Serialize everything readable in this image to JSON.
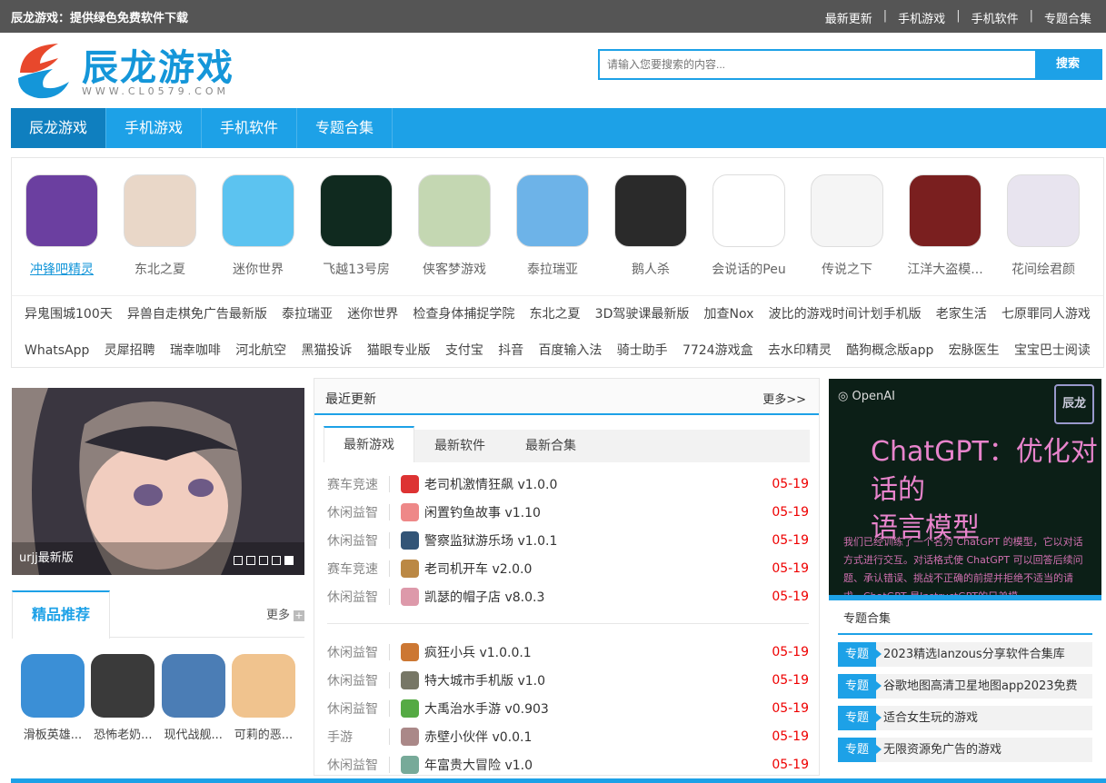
{
  "topbar": {
    "title": "辰龙游戏：提供绿色免费软件下载",
    "links": [
      "最新更新",
      "手机游戏",
      "手机软件",
      "专题合集"
    ],
    "separator": "|"
  },
  "logo": {
    "brand": "辰龙游戏",
    "url": "WWW.CL0579.COM"
  },
  "search": {
    "placeholder": "请输入您要搜索的内容...",
    "button": "搜索"
  },
  "nav": [
    "辰龙游戏",
    "手机游戏",
    "手机软件",
    "专题合集"
  ],
  "apps": [
    {
      "name": "冲锋吧精灵",
      "color": "#6b3fa0",
      "icon": "pokemon-icon"
    },
    {
      "name": "东北之夏",
      "color": "#e9d7c8",
      "icon": "anime-girls-icon"
    },
    {
      "name": "迷你世界",
      "color": "#5cc3f0",
      "icon": "mini-world-icon"
    },
    {
      "name": "飞越13号房",
      "color": "#102a1f",
      "icon": "room13-icon"
    },
    {
      "name": "侠客梦游戏",
      "color": "#c4d7b2",
      "icon": "swordsman-icon"
    },
    {
      "name": "泰拉瑞亚",
      "color": "#6db3e8",
      "icon": "terraria-tree-icon"
    },
    {
      "name": "鹅人杀",
      "color": "#2a2a2a",
      "icon": "goose-icon"
    },
    {
      "name": "会说话的Peu",
      "color": "#ffffff",
      "icon": "peu-icon"
    },
    {
      "name": "传说之下",
      "color": "#f5f5f5",
      "icon": "heart-icon"
    },
    {
      "name": "江洋大盗模...",
      "color": "#7a1f1f",
      "icon": "thief-icon"
    },
    {
      "name": "花间绘君颜",
      "color": "#e8e4ef",
      "icon": "anime-man-icon"
    }
  ],
  "tags": [
    [
      "异鬼围城100天",
      "异兽自走棋免广告最新版",
      "泰拉瑞亚",
      "迷你世界",
      "检查身体捕捉学院",
      "东北之夏",
      "3D驾驶课最新版",
      "加查Nox",
      "波比的游戏时间计划手机版",
      "老家生活",
      "七原罪同人游戏"
    ],
    [
      "WhatsApp",
      "灵犀招聘",
      "瑞幸咖啡",
      "河北航空",
      "黑猫投诉",
      "猫眼专业版",
      "支付宝",
      "抖音",
      "百度输入法",
      "骑士助手",
      "7724游戏盒",
      "去水印精灵",
      "酷狗概念版app",
      "宏脉医生",
      "宝宝巴士阅读"
    ]
  ],
  "hero": {
    "caption": "urjj最新版",
    "slides": 5,
    "active": 5
  },
  "recommend": {
    "title": "精品推荐",
    "more": "更多",
    "apps": [
      {
        "name": "滑板英雄...",
        "color": "#3b8fd6"
      },
      {
        "name": "恐怖老奶...",
        "color": "#3a3a3a"
      },
      {
        "name": "现代战舰...",
        "color": "#4b7db5"
      },
      {
        "name": "可莉的恶...",
        "color": "#f0c38e"
      }
    ]
  },
  "latest": {
    "title": "最近更新",
    "more": "更多>>",
    "tabs": [
      "最新游戏",
      "最新软件",
      "最新合集"
    ],
    "group1": [
      {
        "cat": "赛车竞速",
        "name": "老司机激情狂飙 v1.0.0",
        "date": "05-19",
        "color": "#d33"
      },
      {
        "cat": "休闲益智",
        "name": "闲置钓鱼故事 v1.10",
        "date": "05-19",
        "color": "#e88"
      },
      {
        "cat": "休闲益智",
        "name": "警察监狱游乐场 v1.0.1",
        "date": "05-19",
        "color": "#357"
      },
      {
        "cat": "赛车竞速",
        "name": "老司机开车 v2.0.0",
        "date": "05-19",
        "color": "#b84"
      },
      {
        "cat": "休闲益智",
        "name": "凯瑟的帽子店 v8.0.3",
        "date": "05-19",
        "color": "#d9a"
      }
    ],
    "group2": [
      {
        "cat": "休闲益智",
        "name": "疯狂小兵 v1.0.0.1",
        "date": "05-19",
        "color": "#c73"
      },
      {
        "cat": "休闲益智",
        "name": "特大城市手机版 v1.0",
        "date": "05-19",
        "color": "#776"
      },
      {
        "cat": "休闲益智",
        "name": "大禹治水手游 v0.903",
        "date": "05-19",
        "color": "#5a4"
      },
      {
        "cat": "手游",
        "name": "赤壁小伙伴 v0.0.1",
        "date": "05-19",
        "color": "#a88"
      },
      {
        "cat": "休闲益智",
        "name": "年富贵大冒险 v1.0",
        "date": "05-19",
        "color": "#7a9"
      }
    ]
  },
  "banner": {
    "brand": "OpenAI",
    "logo": "辰龙",
    "headline1": "ChatGPT：优化对话的",
    "headline2": "语言模型",
    "body": "我们已经训练了一个名为 ChatGPT 的模型，它以对话方式进行交互。对话格式使 ChatGPT 可以回答后续问题、承认错误、挑战不正确的前提并拒绝不适当的请求。ChatGPT 是InstructGPT的兄弟模"
  },
  "topics": {
    "title": "专题合集",
    "tag": "专题",
    "items": [
      "2023精选lanzous分享软件合集库",
      "谷歌地图高清卫星地图app2023免费",
      "适合女生玩的游戏",
      "无限资源免广告的游戏"
    ]
  }
}
